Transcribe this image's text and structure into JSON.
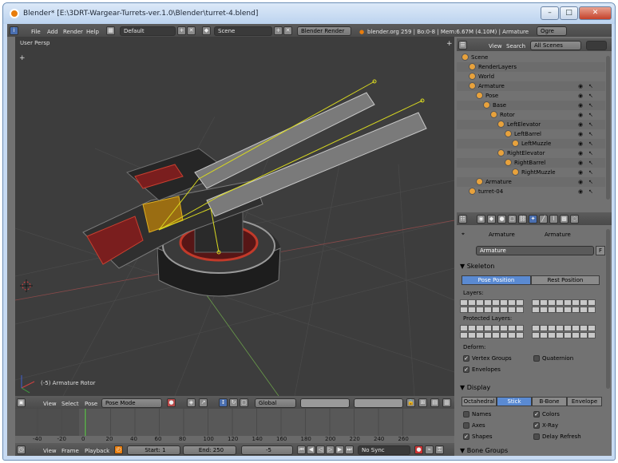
{
  "window": {
    "title": "Blender* [E:\\3DRT-Wargear-Turrets-ver.1.0\\Blender\\turret-4.blend]",
    "min": "–",
    "max": "□",
    "close": "✕"
  },
  "info_header": {
    "menus": [
      "File",
      "Add",
      "Render",
      "Help"
    ],
    "layout": "Default",
    "scene": "Scene",
    "engine": "Blender Render",
    "stats": "blender.org 259 | Bo:0-8 | Mem:6.67M (4.10M) | Armature",
    "ogre": "Ogre"
  },
  "viewport": {
    "view_label": "User Persp",
    "object_label": "(-5) Armature Rotor"
  },
  "view3d_header": {
    "menus": [
      "View",
      "Select",
      "Pose"
    ],
    "mode": "Pose Mode",
    "orientation": "Global"
  },
  "timeline": {
    "ticks": [
      "-40",
      "-20",
      "0",
      "20",
      "40",
      "60",
      "80",
      "100",
      "120",
      "140",
      "160",
      "180",
      "200",
      "220",
      "240",
      "260"
    ],
    "menus": [
      "View",
      "Frame",
      "Playback"
    ],
    "start": "Start: 1",
    "end": "End: 250",
    "current": "-5",
    "sync": "No Sync"
  },
  "outliner": {
    "menus": [
      "View",
      "Search"
    ],
    "filter": "All Scenes",
    "rows": [
      {
        "label": "Scene",
        "indent": 0
      },
      {
        "label": "RenderLayers",
        "indent": 1
      },
      {
        "label": "World",
        "indent": 1
      },
      {
        "label": "Armature",
        "indent": 1
      },
      {
        "label": "Pose",
        "indent": 2
      },
      {
        "label": "Base",
        "indent": 3
      },
      {
        "label": "Rotor",
        "indent": 4
      },
      {
        "label": "LeftElevator",
        "indent": 5
      },
      {
        "label": "LeftBarrel",
        "indent": 6
      },
      {
        "label": "LeftMuzzle",
        "indent": 7
      },
      {
        "label": "RightElevator",
        "indent": 5
      },
      {
        "label": "RightBarrel",
        "indent": 6
      },
      {
        "label": "RightMuzzle",
        "indent": 7
      },
      {
        "label": "Armature",
        "indent": 2
      },
      {
        "label": "turret-04",
        "indent": 1
      }
    ]
  },
  "properties": {
    "breadcrumb": [
      "Armature",
      "Armature"
    ],
    "name": "Armature",
    "fake": "F",
    "skeleton": {
      "title": "Skeleton",
      "pose_position": "Pose Position",
      "rest_position": "Rest Position",
      "layers": "Layers:",
      "protected_layers": "Protected Layers:",
      "deform": "Deform:",
      "vertex_groups": "Vertex Groups",
      "quaternion": "Quaternion",
      "envelopes": "Envelopes"
    },
    "display": {
      "title": "Display",
      "types": [
        "Octahedral",
        "Stick",
        "B-Bone",
        "Envelope"
      ],
      "active_type": "Stick",
      "names": "Names",
      "colors": "Colors",
      "axes": "Axes",
      "xray": "X-Ray",
      "shapes": "Shapes",
      "delay_refresh": "Delay Refresh"
    },
    "bone_groups": "Bone Groups"
  }
}
